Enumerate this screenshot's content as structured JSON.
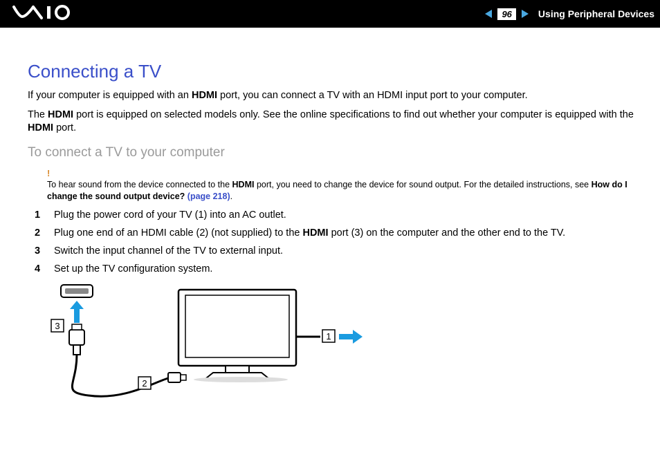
{
  "header": {
    "page_number": "96",
    "section": "Using Peripheral Devices"
  },
  "title": "Connecting a TV",
  "para1_pre": "If your computer is equipped with an ",
  "para1_b1": "HDMI",
  "para1_post": " port, you can connect a TV with an HDMI input port to your computer.",
  "para2_pre": "The ",
  "para2_b1": "HDMI",
  "para2_mid": " port is equipped on selected models only. See the online specifications to find out whether your computer is equipped with the ",
  "para2_b2": "HDMI",
  "para2_post": " port.",
  "subheading": "To connect a TV to your computer",
  "note": {
    "excl": "!",
    "pre": "To hear sound from the device connected to the ",
    "b1": "HDMI",
    "mid": " port, you need to change the device for sound output. For the detailed instructions, see ",
    "b2": "How do I change the sound output device? ",
    "link": "(page 218)",
    "post": "."
  },
  "steps": [
    {
      "n": "1",
      "text": "Plug the power cord of your TV (1) into an AC outlet."
    },
    {
      "n": "2",
      "pre": "Plug one end of an HDMI cable (2) (not supplied) to the ",
      "b": "HDMI",
      "post": " port (3) on the computer and the other end to the TV."
    },
    {
      "n": "3",
      "text": "Switch the input channel of the TV to external input."
    },
    {
      "n": "4",
      "text": "Set up the TV configuration system."
    }
  ],
  "diagram": {
    "labels": {
      "l1": "1",
      "l2": "2",
      "l3": "3"
    }
  }
}
